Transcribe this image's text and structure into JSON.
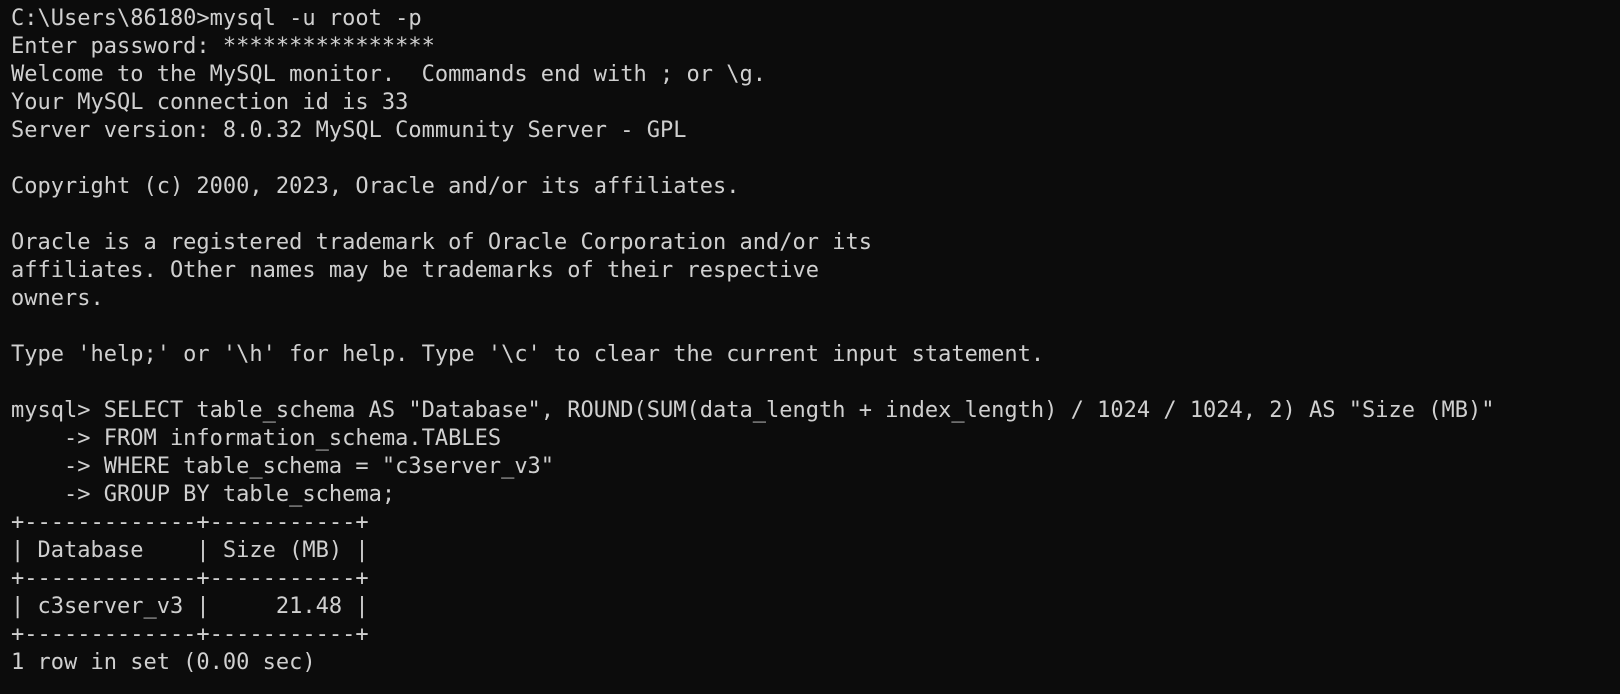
{
  "terminal": {
    "background_color": "#0c0c0c",
    "text_color": "#cccccc",
    "lines": [
      "C:\\Users\\86180>mysql -u root -p",
      "Enter password: ****************",
      "Welcome to the MySQL monitor.  Commands end with ; or \\g.",
      "Your MySQL connection id is 33",
      "Server version: 8.0.32 MySQL Community Server - GPL",
      "",
      "Copyright (c) 2000, 2023, Oracle and/or its affiliates.",
      "",
      "Oracle is a registered trademark of Oracle Corporation and/or its",
      "affiliates. Other names may be trademarks of their respective",
      "owners.",
      "",
      "Type 'help;' or '\\h' for help. Type '\\c' to clear the current input statement.",
      "",
      "mysql> SELECT table_schema AS \"Database\", ROUND(SUM(data_length + index_length) / 1024 / 1024, 2) AS \"Size (MB)\"",
      "    -> FROM information_schema.TABLES",
      "    -> WHERE table_schema = \"c3server_v3\"",
      "    -> GROUP BY table_schema;",
      "+-------------+-----------+",
      "| Database    | Size (MB) |",
      "+-------------+-----------+",
      "| c3server_v3 |     21.48 |",
      "+-------------+-----------+",
      "1 row in set (0.00 sec)"
    ]
  }
}
